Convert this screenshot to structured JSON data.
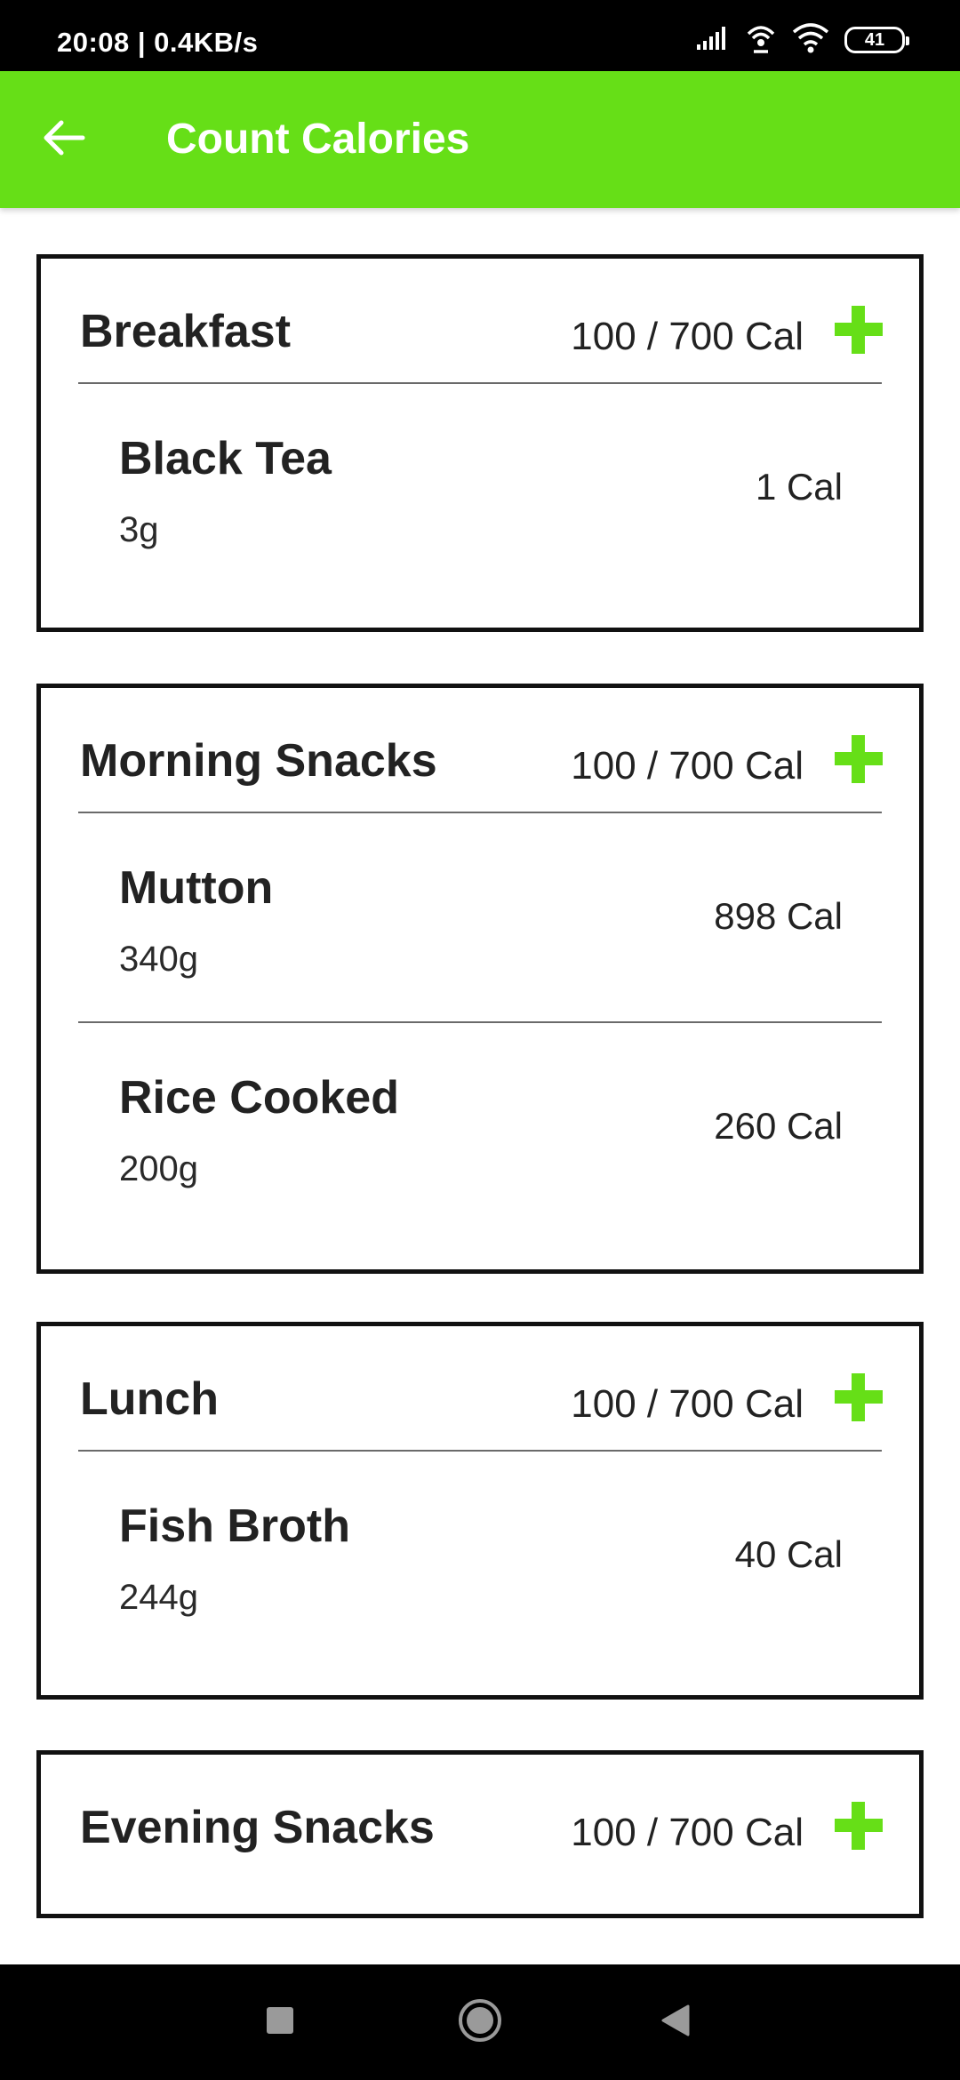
{
  "status_bar": {
    "time": "20:08 | 0.4KB/s",
    "battery": "41",
    "icons": [
      "signal-icon",
      "hotspot-icon",
      "wifi-icon",
      "battery-icon"
    ]
  },
  "app_bar": {
    "title": "Count Calories",
    "back_icon": "arrow-left-icon"
  },
  "colors": {
    "accent": "#66df17",
    "text": "#222222",
    "border": "#111111"
  },
  "meals": [
    {
      "title": "Breakfast",
      "calories": "100 / 700 Cal",
      "items": [
        {
          "name": "Black Tea",
          "weight": "3g",
          "calories": "1 Cal"
        }
      ]
    },
    {
      "title": "Morning Snacks",
      "calories": "100 / 700 Cal",
      "items": [
        {
          "name": "Mutton",
          "weight": "340g",
          "calories": "898 Cal"
        },
        {
          "name": "Rice Cooked",
          "weight": "200g",
          "calories": "260 Cal"
        }
      ]
    },
    {
      "title": "Lunch",
      "calories": "100 / 700 Cal",
      "items": [
        {
          "name": "Fish Broth",
          "weight": "244g",
          "calories": "40 Cal"
        }
      ]
    },
    {
      "title": "Evening Snacks",
      "calories": "100 / 700 Cal",
      "items": []
    }
  ],
  "nav_bar": {
    "icons": [
      "recents-square-icon",
      "home-circle-icon",
      "back-triangle-icon"
    ]
  }
}
